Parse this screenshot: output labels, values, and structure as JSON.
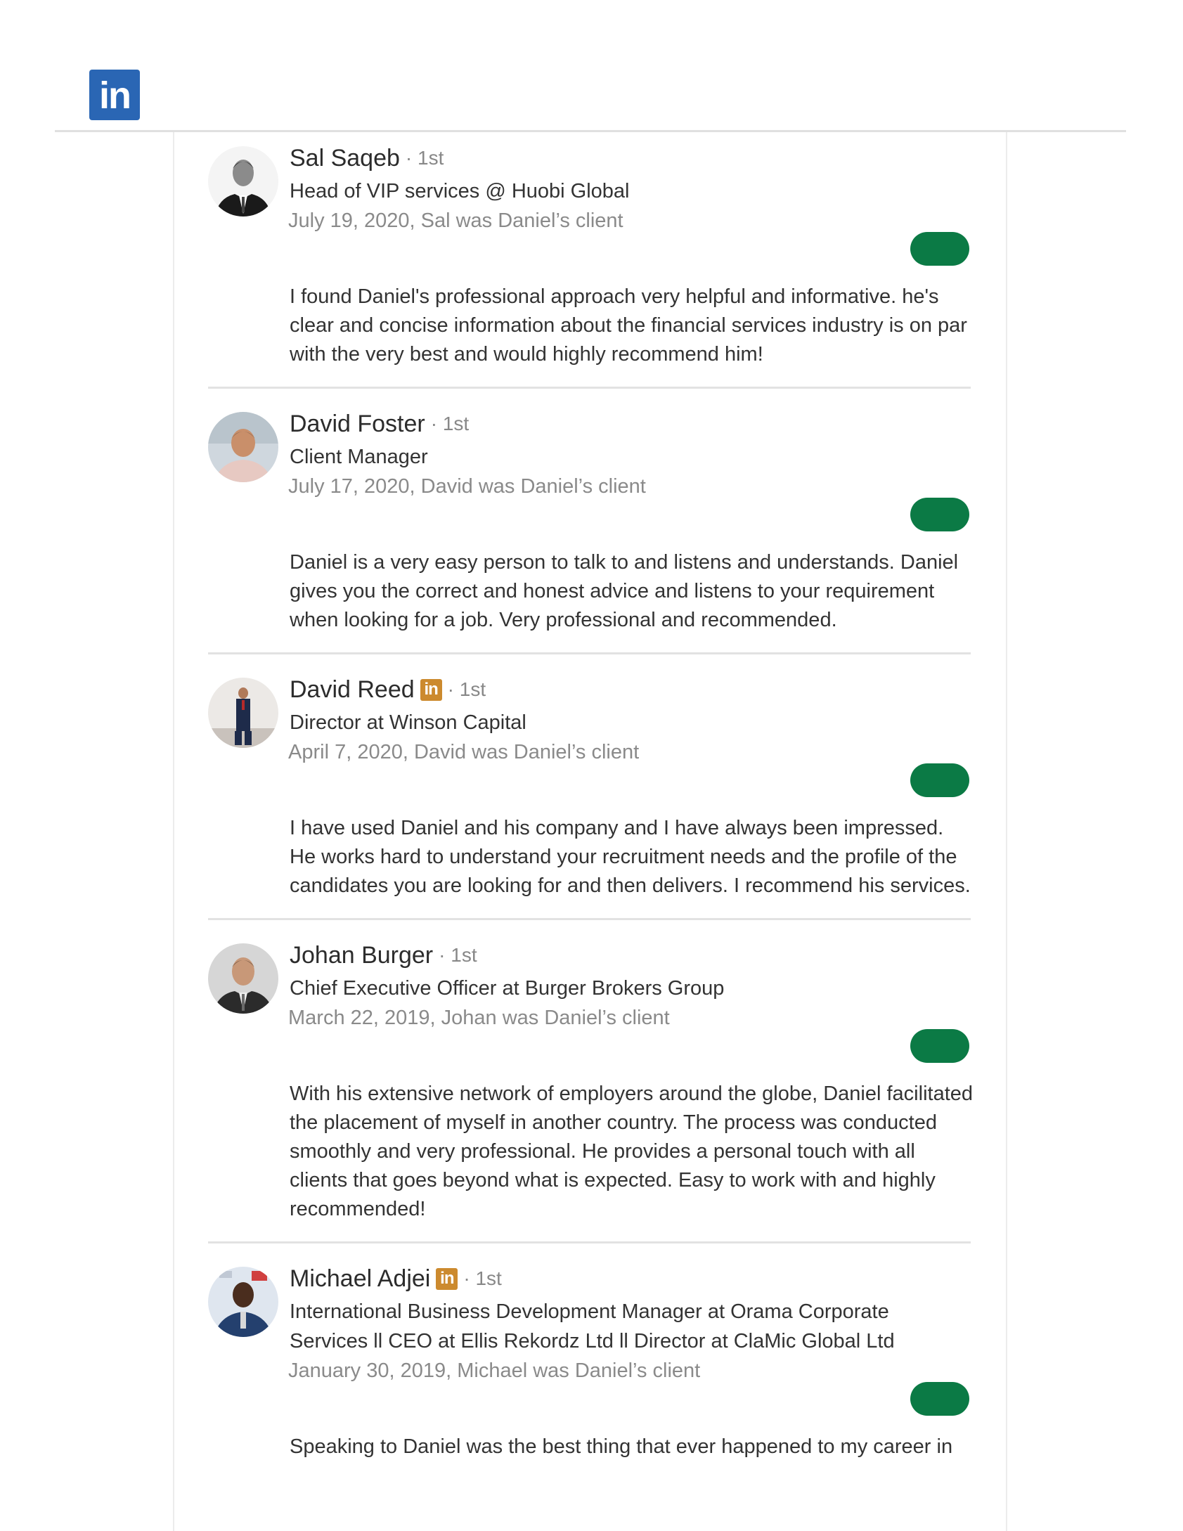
{
  "colors": {
    "linkedin_blue": "#2a66b4",
    "influencer_badge": "#cc8a2e",
    "pill_green": "#0b7a45"
  },
  "logo": {
    "text": "in",
    "icon": "linkedin-logo"
  },
  "recommendations": [
    {
      "name": "Sal Saqeb",
      "badge": "",
      "degree": "· 1st",
      "title": "Head of VIP services @ Huobi Global",
      "date": "July 19, 2020, Sal was Daniel’s client",
      "text": "I found Daniel's professional approach very helpful and informative. he's clear and concise information about the financial services industry is on par with the very best and would highly recommend him!"
    },
    {
      "name": "David Foster",
      "badge": "",
      "degree": "· 1st",
      "title": "Client Manager",
      "date": "July 17, 2020, David was Daniel’s client",
      "text": "Daniel is a very easy person to talk to and listens and understands. Daniel gives you the correct and honest advice and listens to your requirement when looking for a job. Very professional and recommended."
    },
    {
      "name": "David Reed",
      "badge": "in",
      "degree": "· 1st",
      "title": "Director at Winson Capital",
      "date": "April 7, 2020, David was Daniel’s client",
      "text": "I have used Daniel and his company and I have always been impressed. He works hard to understand your recruitment needs and the profile of the candidates you are looking for and then delivers. I recommend his services."
    },
    {
      "name": "Johan Burger",
      "badge": "",
      "degree": "· 1st",
      "title": "Chief Executive Officer at Burger Brokers Group",
      "date": "March 22, 2019, Johan was Daniel’s client",
      "text": "With his extensive network of employers around the globe, Daniel facilitated the placement of myself in another country. The process was conducted smoothly and very professional. He provides a personal touch with all clients that goes beyond what is expected. Easy to work with and highly recommended!"
    },
    {
      "name": "Michael Adjei",
      "badge": "in",
      "degree": "· 1st",
      "title": "International Business Development Manager at Orama Corporate Services ll CEO at Ellis Rekordz Ltd ll Director at ClaMic Global Ltd",
      "date": "January 30, 2019, Michael was Daniel’s client",
      "text": "Speaking to Daniel was the best thing that ever happened to my career in"
    }
  ]
}
